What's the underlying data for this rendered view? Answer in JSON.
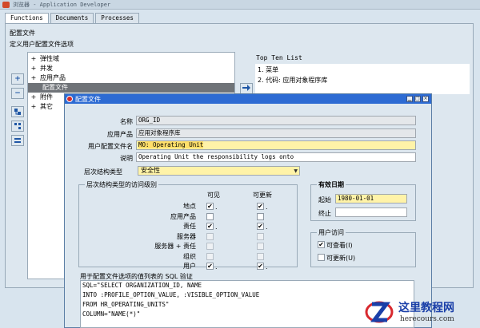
{
  "window": {
    "title": "浏览器 - Application Developer"
  },
  "tabs": [
    {
      "label": "Functions"
    },
    {
      "label": "Documents"
    },
    {
      "label": "Processes"
    }
  ],
  "main": {
    "section_title": "配置文件",
    "section_sub": "定义用户配置文件选项",
    "tree": [
      {
        "prefix": "+",
        "label": "弹性域"
      },
      {
        "prefix": "+",
        "label": "并发"
      },
      {
        "prefix": "+",
        "label": "应用产品"
      },
      {
        "prefix": "",
        "label": "配置文件"
      },
      {
        "prefix": "+",
        "label": "附件"
      },
      {
        "prefix": "+",
        "label": "其它"
      }
    ],
    "side_buttons": [
      "+",
      "−"
    ],
    "top_ten": {
      "title": "Top Ten List",
      "items": [
        "1. 菜单",
        "2. 代码: 应用对象程序库"
      ]
    }
  },
  "dialog": {
    "title": "配置文件",
    "fields": {
      "name_label": "名称",
      "name_value": "ORG_ID",
      "app_label": "应用产品",
      "app_value": "应用对象程序库",
      "user_name_label": "用户配置文件名",
      "user_name_value": "MO: Operating Unit",
      "desc_label": "说明",
      "desc_value": "Operating Unit the responsibility logs onto"
    },
    "hierarchy": {
      "label": "层次结构类型",
      "value": "安全性"
    },
    "access": {
      "title": "层次结构类型的访问级别",
      "col_visible": "可见",
      "col_updatable": "可更新",
      "levels": [
        {
          "label": "地点",
          "visible": true,
          "vis_enabled": true,
          "updatable": true,
          "upd_enabled": true
        },
        {
          "label": "应用产品",
          "visible": false,
          "vis_enabled": true,
          "updatable": false,
          "upd_enabled": true
        },
        {
          "label": "责任",
          "visible": true,
          "vis_enabled": true,
          "updatable": true,
          "upd_enabled": true
        },
        {
          "label": "服务器",
          "visible": false,
          "vis_enabled": false,
          "updatable": false,
          "upd_enabled": false
        },
        {
          "label": "服务器 + 责任",
          "visible": false,
          "vis_enabled": false,
          "updatable": false,
          "upd_enabled": false
        },
        {
          "label": "组织",
          "visible": false,
          "vis_enabled": false,
          "updatable": false,
          "upd_enabled": false
        },
        {
          "label": "用户",
          "visible": true,
          "vis_enabled": true,
          "updatable": true,
          "upd_enabled": true
        }
      ]
    },
    "effective": {
      "title": "有效日期",
      "start_label": "起始",
      "start_value": "1980-01-01",
      "end_label": "终止",
      "end_value": ""
    },
    "user_access": {
      "title": "用户访问",
      "viewable_label": "可查看(I)",
      "viewable": true,
      "updatable_label": "可更新(U)",
      "updatable": false
    },
    "sql": {
      "label": "用于配置文件选项的值列表的 SQL 验证",
      "lines": [
        "SQL=\"SELECT ORGANIZATION_ID, NAME",
        "INTO :PROFILE_OPTION_VALUE, :VISIBLE_OPTION_VALUE",
        "FROM HR_OPERATING_UNITS\"",
        "COLUMN=\"NAME(*)\""
      ]
    }
  },
  "watermark": {
    "title": "这里教程网",
    "url": "herecours.com"
  }
}
